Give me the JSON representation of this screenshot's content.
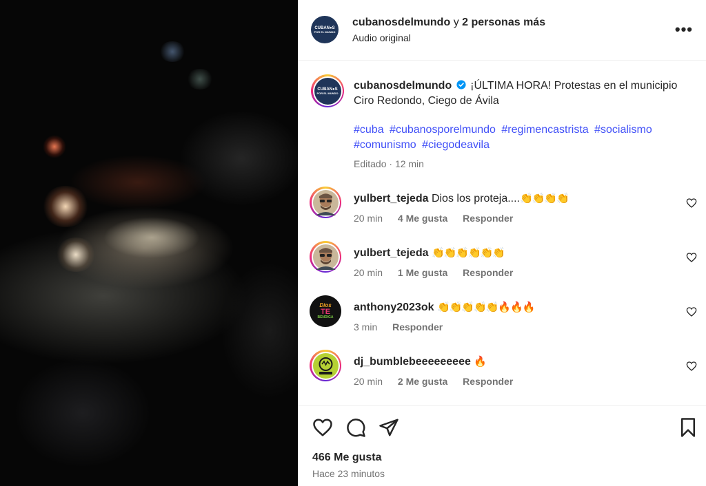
{
  "header": {
    "username": "cubanosdelmundo",
    "connector": "y",
    "others": "2 personas más",
    "audio": "Audio original",
    "more_icon": "more-icon"
  },
  "logo": {
    "line1": "CUBAN●S",
    "line2": "POR EL MUNDO"
  },
  "caption": {
    "username": "cubanosdelmundo",
    "verified_icon": "verified-badge-icon",
    "text": "¡ÚLTIMA HORA! Protestas en el municipio Ciro Redondo, Ciego de Ávila",
    "hashtags": [
      "#cuba",
      "#cubanosporelmundo",
      "#regimencastrista",
      "#socialismo",
      "#comunismo",
      "#ciegodeavila"
    ],
    "edited": "Editado",
    "time": "12 min"
  },
  "comments": [
    {
      "username": "yulbert_tejeda",
      "text": "Dios los proteja....",
      "emoji": "👏👏👏👏",
      "time": "20 min",
      "likes": "4 Me gusta",
      "reply": "Responder"
    },
    {
      "username": "yulbert_tejeda",
      "text": "",
      "emoji": "👏👏👏👏👏👏",
      "time": "20 min",
      "likes": "1 Me gusta",
      "reply": "Responder"
    },
    {
      "username": "anthony2023ok",
      "text": "",
      "emoji": "👏👏👏👏👏🔥🔥🔥",
      "time": "3 min",
      "likes": "",
      "reply": "Responder"
    },
    {
      "username": "dj_bumblebeeeeeeeee",
      "text": "",
      "emoji": "🔥",
      "time": "20 min",
      "likes": "2 Me gusta",
      "reply": "Responder"
    }
  ],
  "anthony_avatar_text": [
    "Dios",
    "TE",
    "BENDIGA"
  ],
  "actions": {
    "icons": [
      "heart-icon",
      "comment-icon",
      "share-icon",
      "save-icon"
    ],
    "likes": "466 Me gusta",
    "posted": "Hace 23 minutos"
  },
  "colors": {
    "hashtag": "#4150f7",
    "secondary_text": "#737373",
    "verified": "#0095f6",
    "logo_bg": "#1f3559"
  }
}
